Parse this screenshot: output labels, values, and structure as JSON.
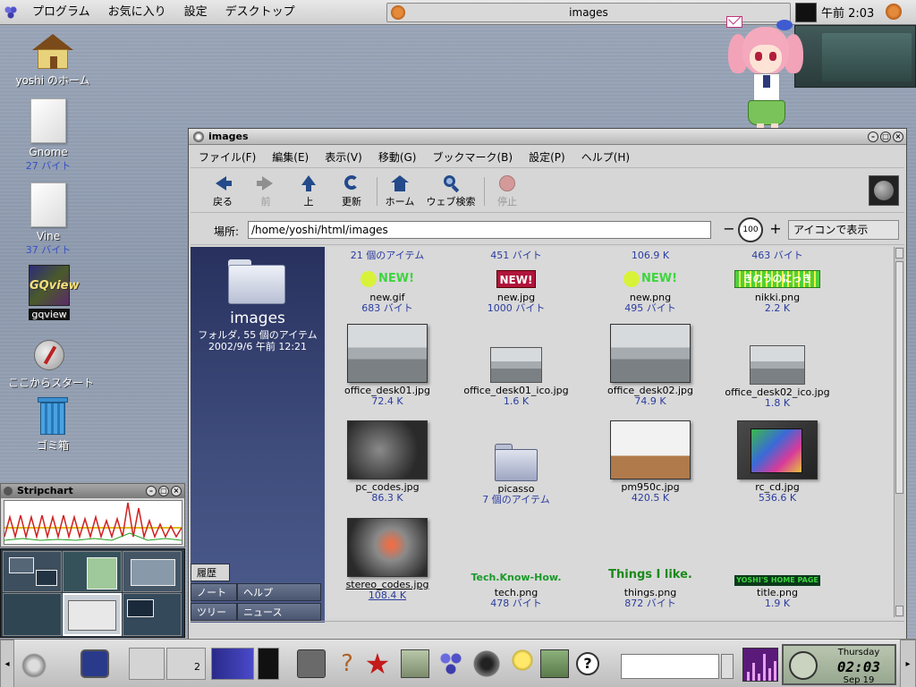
{
  "top_panel": {
    "menu": [
      "プログラム",
      "お気に入り",
      "設定",
      "デスクトップ"
    ],
    "tasklist_title": "images",
    "clock": "午前 2:03"
  },
  "desktop_icons": [
    {
      "label": "yoshi のホーム",
      "sub": ""
    },
    {
      "label": "Gnome",
      "sub": "27 バイト"
    },
    {
      "label": "Vine",
      "sub": "37 バイト"
    },
    {
      "label": "gqview",
      "sub": "",
      "logo_text": "GQview"
    },
    {
      "label": "ここからスタート",
      "sub": ""
    },
    {
      "label": "ゴミ箱",
      "sub": ""
    }
  ],
  "stripchart": {
    "title": "Stripchart"
  },
  "file_manager": {
    "title": "images",
    "menu": [
      "ファイル(F)",
      "編集(E)",
      "表示(V)",
      "移動(G)",
      "ブックマーク(B)",
      "設定(P)",
      "ヘルプ(H)"
    ],
    "toolbar": {
      "back": "戻る",
      "forward": "前",
      "up": "上",
      "refresh": "更新",
      "home": "ホーム",
      "web_search": "ウェブ検索",
      "stop": "停止"
    },
    "location": {
      "label": "場所:",
      "value": "/home/yoshi/html/images"
    },
    "zoom": {
      "minus": "−",
      "level": "100",
      "plus": "+"
    },
    "view_mode": "アイコンで表示",
    "sidebar": {
      "folder_name": "images",
      "info_line1": "フォルダ, 55 個のアイテム",
      "info_line2": "2002/9/6 午前 12:21",
      "tabs": [
        "履歴",
        "ノート",
        "ヘルプ",
        "ツリー",
        "ニュース"
      ]
    },
    "top_partial_row": [
      "21 個のアイテム",
      "451 バイト",
      "106.9 K",
      "463 バイト"
    ],
    "items": [
      {
        "name": "new.gif",
        "size": "683 バイト",
        "badge": "NEW!"
      },
      {
        "name": "new.jpg",
        "size": "1000 バイト",
        "badge": "NEW!"
      },
      {
        "name": "new.png",
        "size": "495 バイト",
        "badge": "NEW!"
      },
      {
        "name": "nikki.png",
        "size": "2.2 K",
        "badge": "きのうのにっき"
      },
      {
        "name": "office_desk01.jpg",
        "size": "72.4 K"
      },
      {
        "name": "office_desk01_ico.jpg",
        "size": "1.6 K"
      },
      {
        "name": "office_desk02.jpg",
        "size": "74.9 K"
      },
      {
        "name": "office_desk02_ico.jpg",
        "size": "1.8 K"
      },
      {
        "name": "pc_codes.jpg",
        "size": "86.3 K"
      },
      {
        "name": "picasso",
        "size": "7 個のアイテム"
      },
      {
        "name": "pm950c.jpg",
        "size": "420.5 K"
      },
      {
        "name": "rc_cd.jpg",
        "size": "536.6 K"
      },
      {
        "name": "stereo_codes.jpg",
        "size": "108.4 K"
      },
      {
        "name": "tech.png",
        "size": "478 バイト",
        "badge": "Tech.Know-How."
      },
      {
        "name": "things.png",
        "size": "872 バイト",
        "badge": "Things I like."
      },
      {
        "name": "title.png",
        "size": "1.9 K",
        "badge": "YOSHI'S HOME PAGE"
      }
    ]
  },
  "bottom_panel": {
    "workspace_num": "2",
    "clock_day": "Thursday",
    "clock_time": "02:03",
    "clock_date": "Sep 19"
  }
}
